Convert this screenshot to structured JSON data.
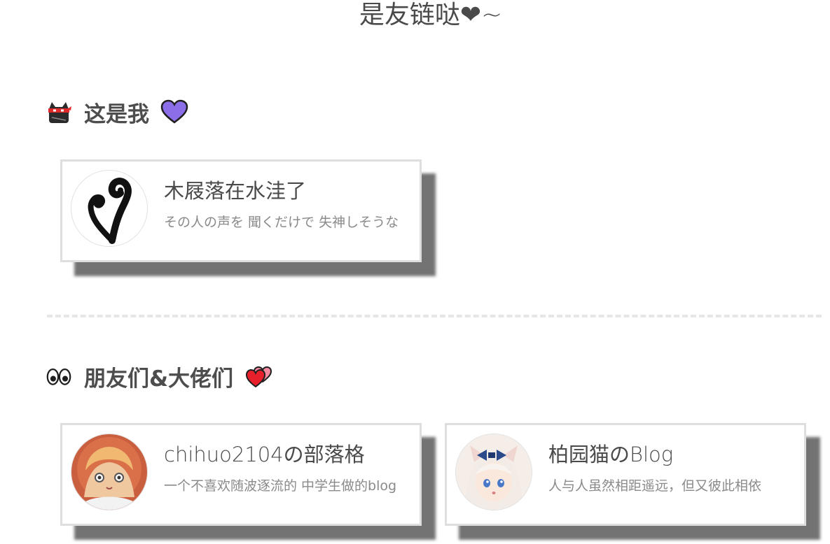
{
  "page": {
    "title": "是友链哒❤~"
  },
  "sections": {
    "me": {
      "heading": "这是我",
      "icon": "ninja-cat-icon",
      "heart_icon": "purple-heart-icon",
      "cards": [
        {
          "name": "木屐落在水洼了",
          "description": "その人の声を 聞くだけで 失神しそうな",
          "avatar_icon": "swirl-logo-icon"
        }
      ]
    },
    "friends": {
      "heading": "朋友们&大佬们",
      "icon": "eyes-icon",
      "heart_icon": "two-hearts-icon",
      "cards": [
        {
          "name": "chihuo2104の部落格",
          "description": "一个不喜欢随波逐流的 中学生做的blog",
          "avatar_icon": "anime-girl-hood-avatar"
        },
        {
          "name": "柏园猫のBlog",
          "description": "人与人虽然相距遥远，但又彼此相依",
          "avatar_icon": "anime-catgirl-avatar"
        }
      ]
    }
  },
  "colors": {
    "text": "#4a4a4a",
    "muted": "#8a8a8a",
    "border": "#dedede",
    "purple_heart": "#8c6fe8",
    "red_heart": "#e8202c"
  }
}
